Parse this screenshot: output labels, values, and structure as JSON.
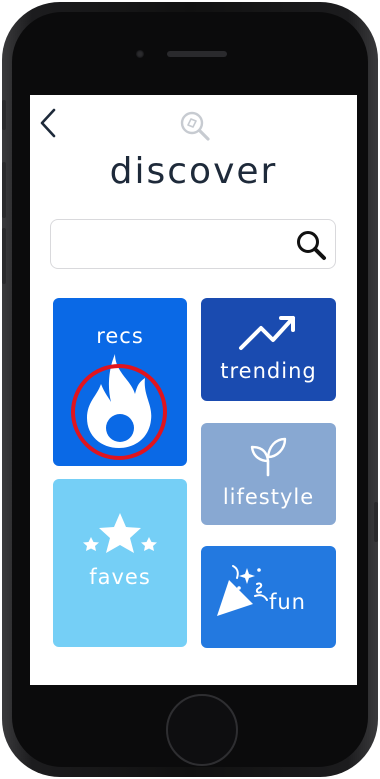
{
  "header": {
    "title": "discover",
    "back_icon": "chevron-left-icon",
    "logo_icon": "magnifier-logo-icon"
  },
  "search": {
    "value": "",
    "placeholder": "",
    "icon": "search-icon"
  },
  "tiles": [
    {
      "id": "recs",
      "label": "recs",
      "icon": "flame-icon",
      "color": "#0a69e6",
      "highlighted": true,
      "highlight_color": "#e0141e"
    },
    {
      "id": "trending",
      "label": "trending",
      "icon": "trend-up-icon",
      "color": "#1a4bb0"
    },
    {
      "id": "lifestyle",
      "label": "lifestyle",
      "icon": "sprout-icon",
      "color": "#88a8d2"
    },
    {
      "id": "faves",
      "label": "faves",
      "icon": "stars-icon",
      "color": "#75cff6"
    },
    {
      "id": "fun",
      "label": "fun",
      "icon": "party-popper-icon",
      "color": "#2379e0"
    }
  ],
  "colors": {
    "title_text": "#1e2a3a",
    "phone_frame": "#111111"
  }
}
